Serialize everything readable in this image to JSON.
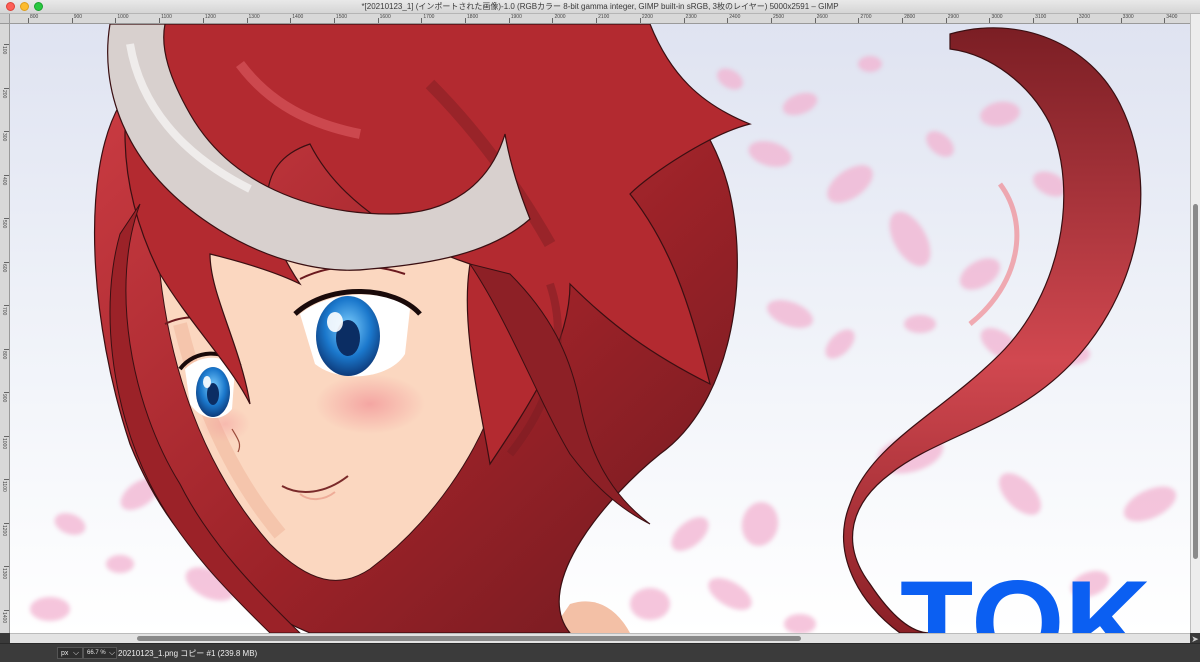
{
  "window": {
    "title": "*[20210123_1] (インポートされた画像)-1.0 (RGBカラー 8-bit gamma integer, GIMP built-in sRGB, 3枚のレイヤー) 5000x2591 – GIMP"
  },
  "ruler": {
    "h_ticks": [
      "800",
      "900",
      "1000",
      "1100",
      "1200",
      "1300",
      "1400",
      "1500",
      "1600",
      "1700",
      "1800",
      "1900",
      "2000",
      "2100",
      "2200",
      "2300",
      "2400",
      "2500",
      "2600",
      "2700",
      "2800",
      "2900",
      "3000",
      "3100",
      "3200",
      "3300",
      "3400"
    ],
    "v_ticks": [
      "100",
      "200",
      "300",
      "400",
      "500",
      "600",
      "700",
      "800",
      "900",
      "1000",
      "1100",
      "1200",
      "1300",
      "1400"
    ]
  },
  "canvas": {
    "overlay_text": "TOK",
    "colors": {
      "hair": "#b32a30",
      "hair_dark": "#7a1c22",
      "hair_light": "#e06068",
      "skin": "#fbd7c0",
      "eye": "#1b78cc",
      "blush": "#f4a7a7",
      "petal": "#f2b2d0",
      "text_blue": "#0b5ff2"
    }
  },
  "status": {
    "unit": "px",
    "zoom": "66.7 %",
    "message": "20210123_1.png コピー #1 (239.8 MB)"
  },
  "icons": {
    "unit_dropdown": "chevron-down-icon",
    "zoom_dropdown": "chevron-down-icon",
    "navigate": "navigate-icon"
  }
}
